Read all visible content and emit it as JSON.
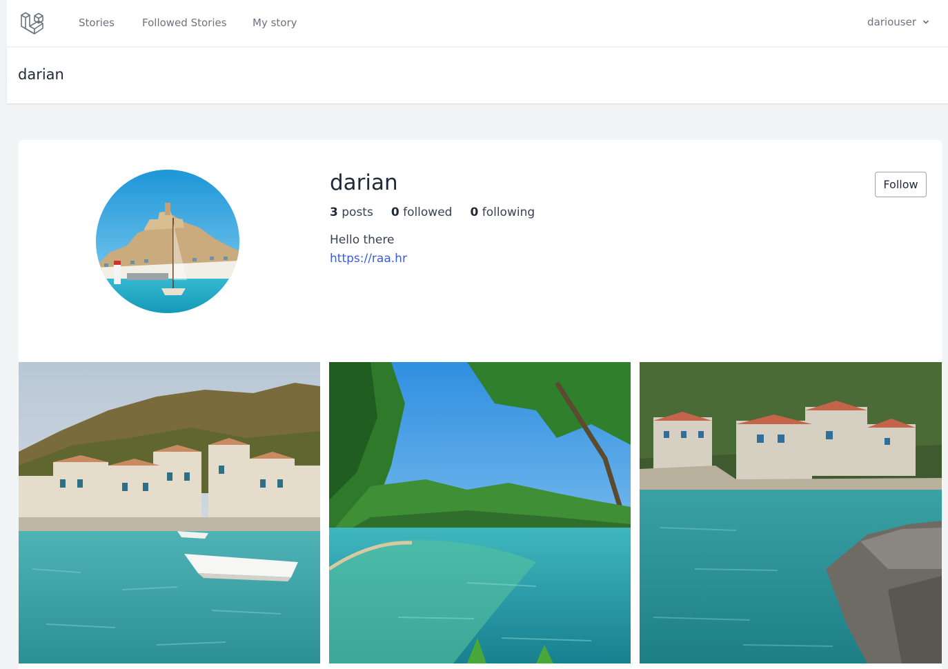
{
  "nav": {
    "links": [
      {
        "label": "Stories"
      },
      {
        "label": "Followed Stories"
      },
      {
        "label": "My story"
      }
    ],
    "user": {
      "name": "dariouser"
    }
  },
  "header": {
    "title": "darian"
  },
  "profile": {
    "name": "darian",
    "posts_count": "3",
    "posts_label": "posts",
    "followed_count": "0",
    "followed_label": "followed",
    "following_count": "0",
    "following_label": "following",
    "bio": "Hello there",
    "link": "https://raa.hr",
    "follow_label": "Follow"
  },
  "colors": {
    "accent": "#3b5bdb",
    "page_bg": "#f3f4f6",
    "logo": "#6b7280"
  }
}
